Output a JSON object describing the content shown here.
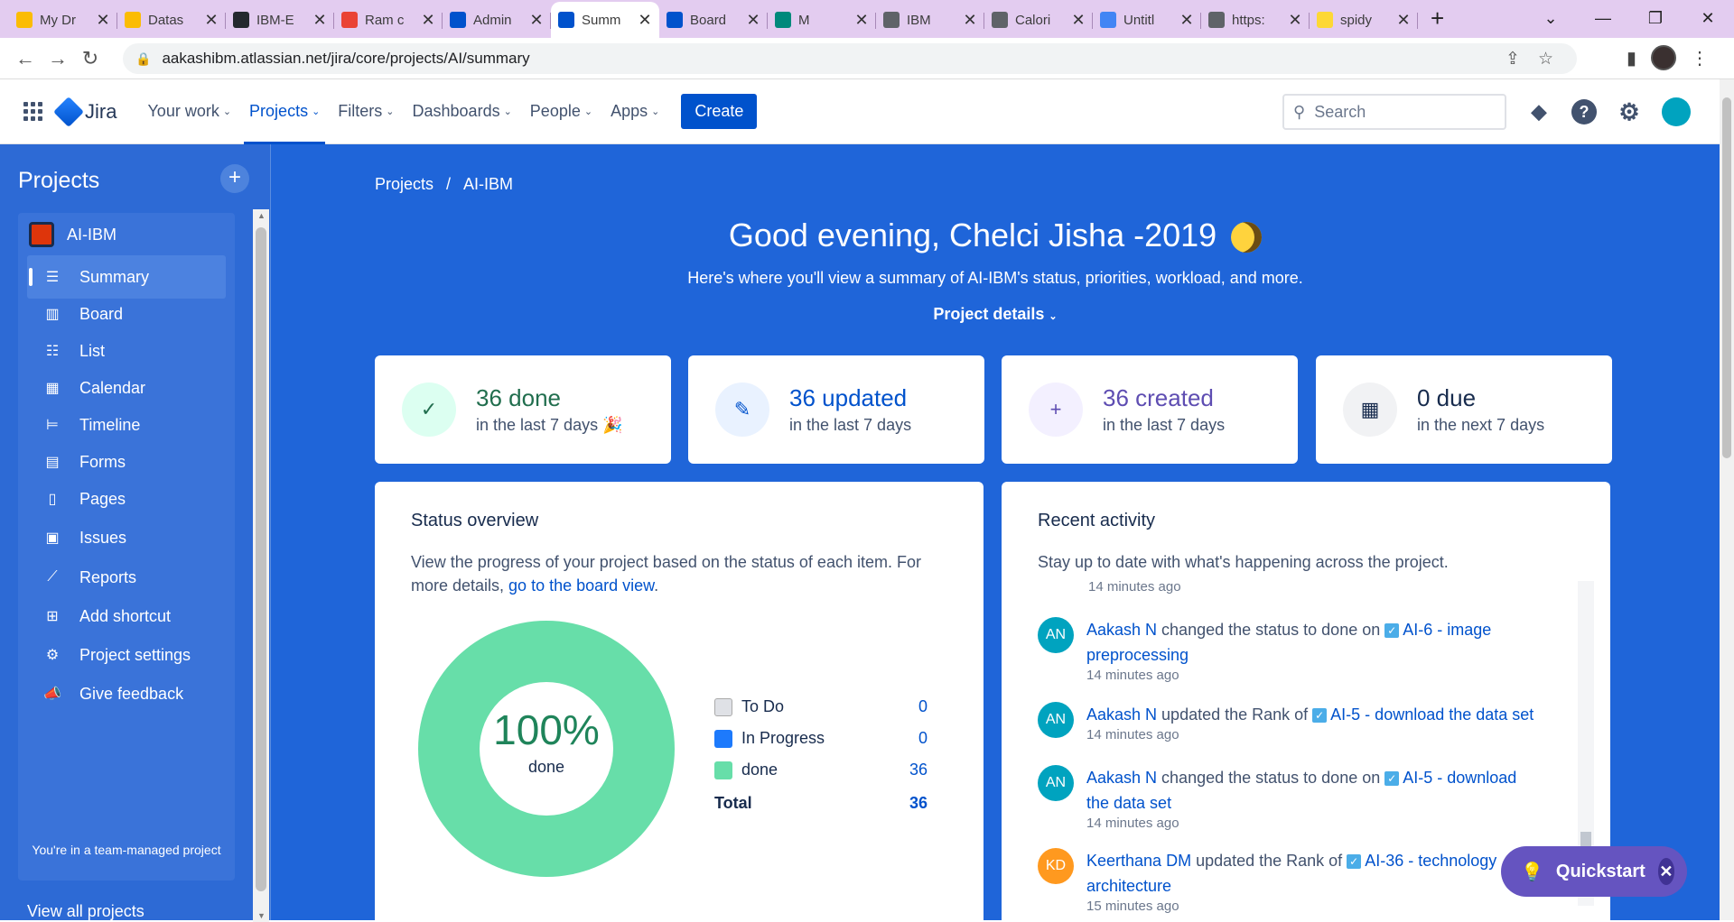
{
  "browser": {
    "tabs": [
      {
        "label": "My Dr",
        "color": "#fbbc04",
        "icon": "drive-icon"
      },
      {
        "label": "Datas",
        "color": "#fbbc04",
        "icon": "drive-icon"
      },
      {
        "label": "IBM-E",
        "color": "#24292e",
        "icon": "github-icon"
      },
      {
        "label": "Ram c",
        "color": "#ea4335",
        "icon": "gmail-icon"
      },
      {
        "label": "Admin",
        "color": "#0052cc",
        "icon": "atlassian-icon"
      },
      {
        "label": "Summ",
        "color": "#0052cc",
        "icon": "jira-icon",
        "active": true
      },
      {
        "label": "Board",
        "color": "#0052cc",
        "icon": "jira-icon"
      },
      {
        "label": "M",
        "color": "#00897b",
        "icon": "meet-icon"
      },
      {
        "label": "IBM",
        "color": "#5f6368",
        "icon": "globe-icon"
      },
      {
        "label": "Calori",
        "color": "#5f6368",
        "icon": "globe-icon"
      },
      {
        "label": "Untitl",
        "color": "#4285f4",
        "icon": "docs-icon"
      },
      {
        "label": "https:",
        "color": "#5f6368",
        "icon": "globe-icon"
      },
      {
        "label": "spidy",
        "color": "#fdd835",
        "icon": "site-icon"
      }
    ],
    "url": "aakashibm.atlassian.net/jira/core/projects/AI/summary"
  },
  "nav": {
    "product": "Jira",
    "items": [
      "Your work",
      "Projects",
      "Filters",
      "Dashboards",
      "People",
      "Apps"
    ],
    "create": "Create",
    "search_placeholder": "Search"
  },
  "sidebar": {
    "title": "Projects",
    "project": "AI-IBM",
    "items": [
      {
        "label": "Summary",
        "icon": "summary-icon",
        "glyph": "☰"
      },
      {
        "label": "Board",
        "icon": "board-icon",
        "glyph": "▥"
      },
      {
        "label": "List",
        "icon": "list-icon",
        "glyph": "☷"
      },
      {
        "label": "Calendar",
        "icon": "calendar-icon",
        "glyph": "▦"
      },
      {
        "label": "Timeline",
        "icon": "timeline-icon",
        "glyph": "⊨"
      },
      {
        "label": "Forms",
        "icon": "forms-icon",
        "glyph": "▤"
      },
      {
        "label": "Pages",
        "icon": "pages-icon",
        "glyph": "▯"
      },
      {
        "label": "Issues",
        "icon": "issues-icon",
        "glyph": "▣"
      },
      {
        "label": "Reports",
        "icon": "reports-icon",
        "glyph": "⟋"
      },
      {
        "label": "Add shortcut",
        "icon": "add-shortcut-icon",
        "glyph": "⊞"
      },
      {
        "label": "Project settings",
        "icon": "gear-icon",
        "glyph": "⚙"
      },
      {
        "label": "Give feedback",
        "icon": "megaphone-icon",
        "glyph": "📣"
      }
    ],
    "note": "You're in a team-managed project",
    "view_all": "View all projects"
  },
  "breadcrumb": [
    "Projects",
    "/",
    "AI-IBM"
  ],
  "greeting": "Good evening, Chelci Jisha -2019",
  "subtitle": "Here's where you'll view a summary of AI-IBM's status, priorities, workload, and more.",
  "project_details": "Project details",
  "stats": [
    {
      "value": "36 done",
      "period": "in the last 7 days 🎉",
      "icon": "check-icon",
      "glyph": "✓",
      "color": "#216e4e",
      "bg": "#dcfff1"
    },
    {
      "value": "36 updated",
      "period": "in the last 7 days",
      "icon": "pencil-icon",
      "glyph": "✎",
      "color": "#0052cc",
      "bg": "#e9f2ff"
    },
    {
      "value": "36 created",
      "period": "in the last 7 days",
      "icon": "plus-icon",
      "glyph": "+",
      "color": "#5e4db2",
      "bg": "#f3f0ff"
    },
    {
      "value": "0 due",
      "period": "in the next 7 days",
      "icon": "calendar-icon",
      "glyph": "▦",
      "color": "#172b4d",
      "bg": "#f1f2f4"
    }
  ],
  "status": {
    "title": "Status overview",
    "desc": "View the progress of your project based on the status of each item. For more details, ",
    "link": "go to the board view",
    "percent": "100%",
    "percent_label": "done",
    "legend": [
      {
        "label": "To Do",
        "value": "0",
        "color": "#dfe1e6"
      },
      {
        "label": "In Progress",
        "value": "0",
        "color": "#1d7afc"
      },
      {
        "label": "done",
        "value": "36",
        "color": "#67dea9"
      }
    ],
    "total_label": "Total",
    "total": "36"
  },
  "activity": {
    "title": "Recent activity",
    "desc": "Stay up to date with what's happening across the project.",
    "top_ago": "14 minutes ago",
    "items": [
      {
        "initials": "AN",
        "color": "#00a3bf",
        "who": "Aakash N",
        "action": " changed the status to done on ",
        "issue": "AI-6 - image preprocessing",
        "ago": "14 minutes ago"
      },
      {
        "initials": "AN",
        "color": "#00a3bf",
        "who": "Aakash N",
        "action": " updated the Rank of ",
        "issue": "AI-5 - download the data set",
        "ago": "14 minutes ago"
      },
      {
        "initials": "AN",
        "color": "#00a3bf",
        "who": "Aakash N",
        "action": " changed the status to done on ",
        "issue": "AI-5 - download the data set",
        "ago": "14 minutes ago"
      },
      {
        "initials": "KD",
        "color": "#ff991f",
        "who": "Keerthana DM",
        "action": " updated the Rank of ",
        "issue": "AI-36 - technology architecture",
        "ago": "15 minutes ago"
      }
    ]
  },
  "quickstart": "Quickstart"
}
